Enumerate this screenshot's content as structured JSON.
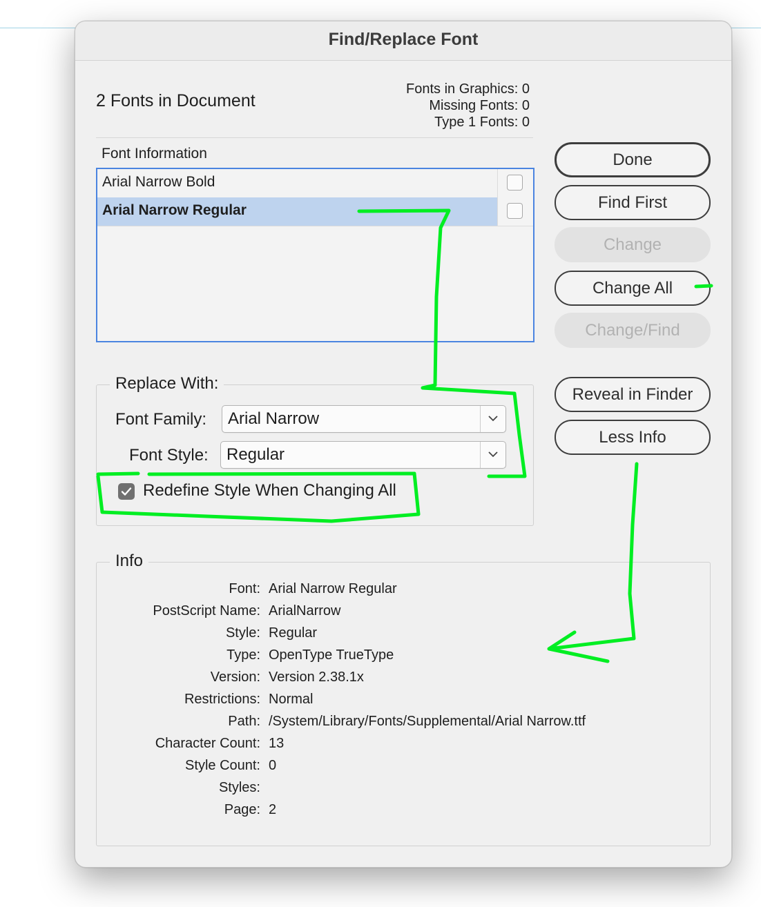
{
  "window": {
    "title": "Find/Replace Font"
  },
  "summary": {
    "fonts_in_document": "2 Fonts in Document",
    "stats": [
      {
        "label": "Fonts in Graphics:",
        "value": "0"
      },
      {
        "label": "Missing Fonts:",
        "value": "0"
      },
      {
        "label": "Type 1 Fonts:",
        "value": "0"
      }
    ]
  },
  "font_list": {
    "label": "Font Information",
    "rows": [
      {
        "name": "Arial Narrow Bold",
        "selected": false,
        "checked": false
      },
      {
        "name": "Arial Narrow Regular",
        "selected": true,
        "checked": false
      }
    ]
  },
  "replace_with": {
    "title": "Replace With:",
    "font_family": {
      "label": "Font Family:",
      "value": "Arial Narrow"
    },
    "font_style": {
      "label": "Font Style:",
      "value": "Regular"
    },
    "redefine": {
      "label": "Redefine Style When Changing All",
      "checked": true
    }
  },
  "buttons": {
    "done": "Done",
    "find_first": "Find First",
    "change": "Change",
    "change_all": "Change All",
    "change_find": "Change/Find",
    "reveal": "Reveal in Finder",
    "less_info": "Less Info"
  },
  "info": {
    "title": "Info",
    "rows": [
      {
        "key": "Font:",
        "value": "Arial Narrow Regular"
      },
      {
        "key": "PostScript Name:",
        "value": "ArialNarrow"
      },
      {
        "key": "Style:",
        "value": "Regular"
      },
      {
        "key": "Type:",
        "value": "OpenType TrueType"
      },
      {
        "key": "Version:",
        "value": "Version 2.38.1x"
      },
      {
        "key": "Restrictions:",
        "value": "Normal"
      },
      {
        "key": "Path:",
        "value": "/System/Library/Fonts/Supplemental/Arial Narrow.ttf"
      },
      {
        "key": "Character Count:",
        "value": "13"
      },
      {
        "key": "Style Count:",
        "value": "0"
      },
      {
        "key": "Styles:",
        "value": ""
      },
      {
        "key": "Page:",
        "value": "2"
      }
    ]
  },
  "colors": {
    "selection": "#bed3ee",
    "list_border": "#4a84e0",
    "annotation": "#00ee22"
  }
}
